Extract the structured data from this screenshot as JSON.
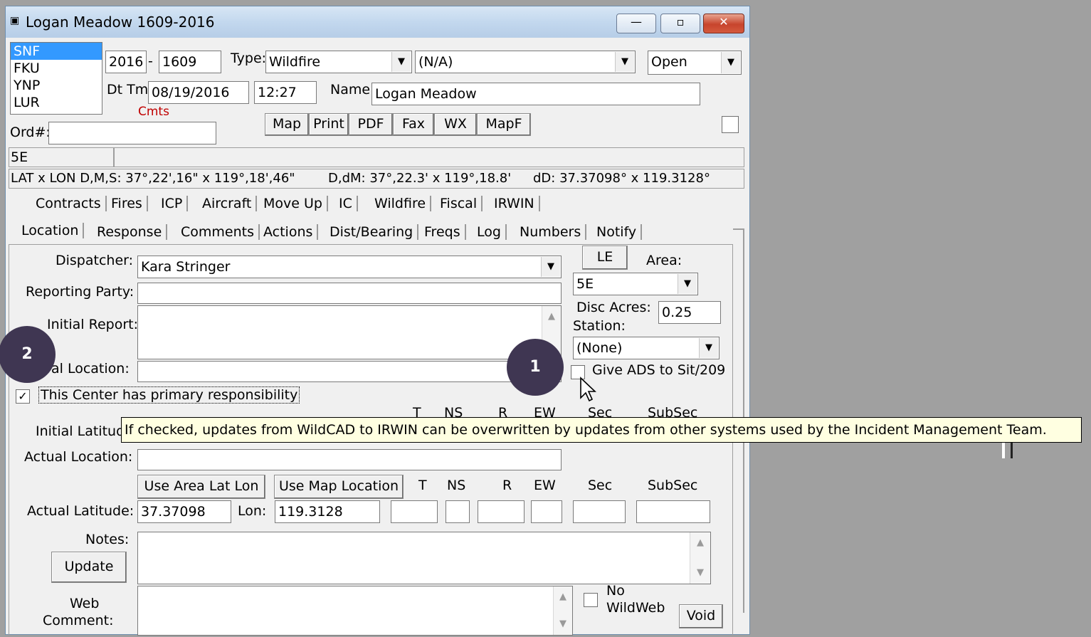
{
  "window": {
    "title": "Logan Meadow 1609-2016",
    "minimize_label": "—",
    "restore_label": "▫",
    "close_label": "✕"
  },
  "dispatch_list": [
    "SNF",
    "FKU",
    "YNP",
    "LUR"
  ],
  "header": {
    "year": "2016",
    "dash": "-",
    "number": "1609",
    "type_label": "Type:",
    "type_value": "Wildfire",
    "subtype_value": "(N/A)",
    "status_value": "Open",
    "dttm_label": "Dt Tm",
    "date_value": "08/19/2016",
    "time_value": "12:27",
    "name_label": "Name:",
    "name_value": "Logan Meadow",
    "cmts_label": "Cmts",
    "ord_label": "Ord#:",
    "ord_value": ""
  },
  "toolbar": [
    "Map",
    "Print",
    "PDF",
    "Fax",
    "WX",
    "MapF"
  ],
  "area_code": "5E",
  "coords_line": {
    "dms": "LAT x LON D,M,S: 37°,22',16\" x 119°,18',46\"",
    "ddm": "D,dM: 37°,22.3' x 119°,18.8'",
    "dd": "dD: 37.37098° x 119.3128°"
  },
  "tabs_row1": [
    "Contracts",
    "Fires",
    "ICP",
    "Aircraft",
    "Move Up",
    "IC",
    "Wildfire",
    "Fiscal",
    "IRWIN"
  ],
  "tabs_row2": [
    "Location",
    "Response",
    "Comments",
    "Actions",
    "Dist/Bearing",
    "Freqs",
    "Log",
    "Numbers",
    "Notify"
  ],
  "form": {
    "dispatcher_label": "Dispatcher:",
    "dispatcher_value": "Kara Stringer",
    "reporting_party_label": "Reporting Party:",
    "reporting_party_value": "",
    "initial_report_label": "Initial Report:",
    "initial_location_label": "al Location:",
    "primary_resp_label": "This Center has primary responsibility",
    "initial_latitude_label": "Initial Latitude",
    "actual_location_label": "Actual Location:",
    "use_area_btn": "Use Area Lat Lon",
    "use_map_btn": "Use Map Location",
    "actual_latitude_label": "Actual Latitude:",
    "lat_value": "37.37098",
    "lon_label": "Lon:",
    "lon_value": "119.3128",
    "notes_label": "Notes:",
    "update_btn": "Update",
    "web_label": "Web",
    "comment_label": "Comment:",
    "no_label": "No",
    "wildweb_label": "WildWeb",
    "void_btn": "Void"
  },
  "trs_headers": [
    "T",
    "NS",
    "R",
    "EW",
    "Sec",
    "SubSec"
  ],
  "right_panel": {
    "le_btn": "LE",
    "area_label": "Area:",
    "area_value": "5E",
    "disc_acres_label": "Disc Acres:",
    "disc_acres_value": "0.25",
    "station_label": "Station:",
    "station_value": "(None)",
    "give_ads_label": "Give ADS to Sit/209"
  },
  "tooltip": "If checked, updates from WildCAD to IRWIN can be overwritten by updates from other systems used by the Incident Management Team.",
  "badges": [
    "1",
    "2"
  ],
  "colors": {
    "cmts": "#c00000",
    "badge": "#3f3652",
    "tooltip_bg": "#ffffe1",
    "selection": "#3399ff"
  }
}
